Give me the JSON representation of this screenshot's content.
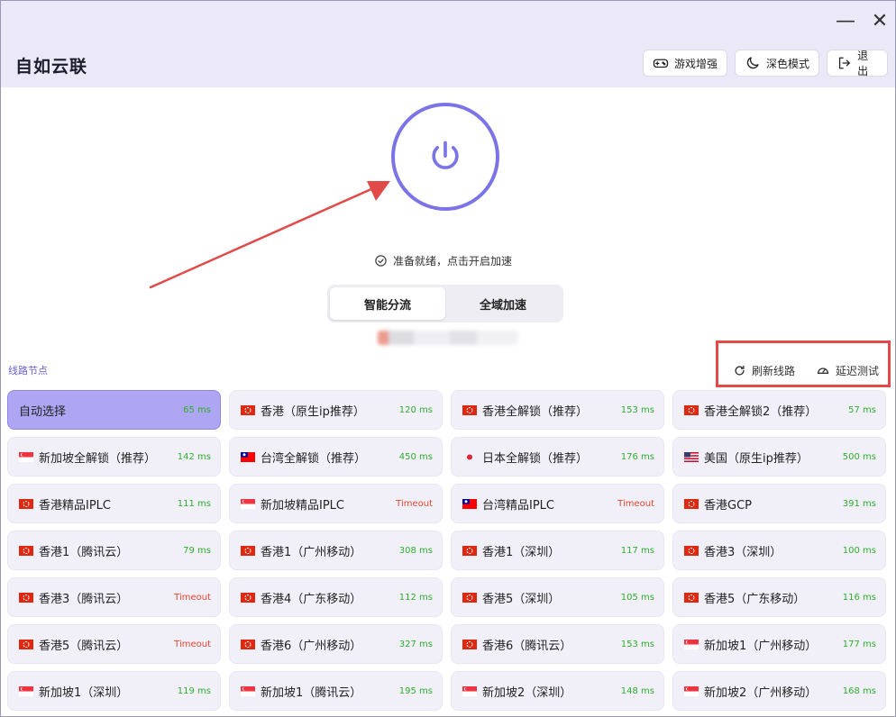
{
  "window": {
    "minimize_glyph": "—",
    "close_glyph": "✕"
  },
  "app": {
    "title": "自如云联"
  },
  "header": {
    "game_label": "游戏增强",
    "dark_label": "深色模式",
    "exit_label": "退出"
  },
  "status": {
    "text": "准备就绪，点击开启加速"
  },
  "mode": {
    "tabs": [
      "智能分流",
      "全域加速"
    ],
    "active_index": 0
  },
  "nodes_section": {
    "label": "线路节点",
    "refresh_label": "刷新线路",
    "latency_label": "延迟测试"
  },
  "colors": {
    "accent": "#7b74e6",
    "selected": "#aea6f3",
    "ok": "#2eae2e",
    "timeout": "#e8452f",
    "annotation": "#e24a4a"
  },
  "nodes": [
    {
      "name": "自动选择",
      "latency": "65 ms",
      "flag": "none",
      "selected": true
    },
    {
      "name": "香港（原生ip推荐）",
      "latency": "120 ms",
      "flag": "hk"
    },
    {
      "name": "香港全解锁（推荐）",
      "latency": "153 ms",
      "flag": "hk"
    },
    {
      "name": "香港全解锁2（推荐）",
      "latency": "57 ms",
      "flag": "hk"
    },
    {
      "name": "新加坡全解锁（推荐）",
      "latency": "142 ms",
      "flag": "sg"
    },
    {
      "name": "台湾全解锁（推荐）",
      "latency": "450 ms",
      "flag": "tw"
    },
    {
      "name": "日本全解锁（推荐）",
      "latency": "176 ms",
      "flag": "jp"
    },
    {
      "name": "美国（原生ip推荐）",
      "latency": "500 ms",
      "flag": "us"
    },
    {
      "name": "香港精品IPLC",
      "latency": "111 ms",
      "flag": "hk"
    },
    {
      "name": "新加坡精品IPLC",
      "latency": "Timeout",
      "flag": "sg"
    },
    {
      "name": "台湾精品IPLC",
      "latency": "Timeout",
      "flag": "tw"
    },
    {
      "name": "香港GCP",
      "latency": "391 ms",
      "flag": "hk"
    },
    {
      "name": "香港1（腾讯云）",
      "latency": "79 ms",
      "flag": "hk"
    },
    {
      "name": "香港1（广州移动）",
      "latency": "308 ms",
      "flag": "hk"
    },
    {
      "name": "香港1（深圳）",
      "latency": "117 ms",
      "flag": "hk"
    },
    {
      "name": "香港3（深圳）",
      "latency": "100 ms",
      "flag": "hk"
    },
    {
      "name": "香港3（腾讯云）",
      "latency": "Timeout",
      "flag": "hk"
    },
    {
      "name": "香港4（广东移动）",
      "latency": "112 ms",
      "flag": "hk"
    },
    {
      "name": "香港5（深圳）",
      "latency": "105 ms",
      "flag": "hk"
    },
    {
      "name": "香港5（广东移动）",
      "latency": "116 ms",
      "flag": "hk"
    },
    {
      "name": "香港5（腾讯云）",
      "latency": "Timeout",
      "flag": "hk"
    },
    {
      "name": "香港6（广州移动）",
      "latency": "327 ms",
      "flag": "hk"
    },
    {
      "name": "香港6（腾讯云）",
      "latency": "153 ms",
      "flag": "hk"
    },
    {
      "name": "新加坡1（广州移动）",
      "latency": "177 ms",
      "flag": "sg"
    },
    {
      "name": "新加坡1（深圳）",
      "latency": "119 ms",
      "flag": "sg"
    },
    {
      "name": "新加坡1（腾讯云）",
      "latency": "195 ms",
      "flag": "sg"
    },
    {
      "name": "新加坡2（深圳）",
      "latency": "148 ms",
      "flag": "sg"
    },
    {
      "name": "新加坡2（广州移动）",
      "latency": "168 ms",
      "flag": "sg"
    }
  ]
}
